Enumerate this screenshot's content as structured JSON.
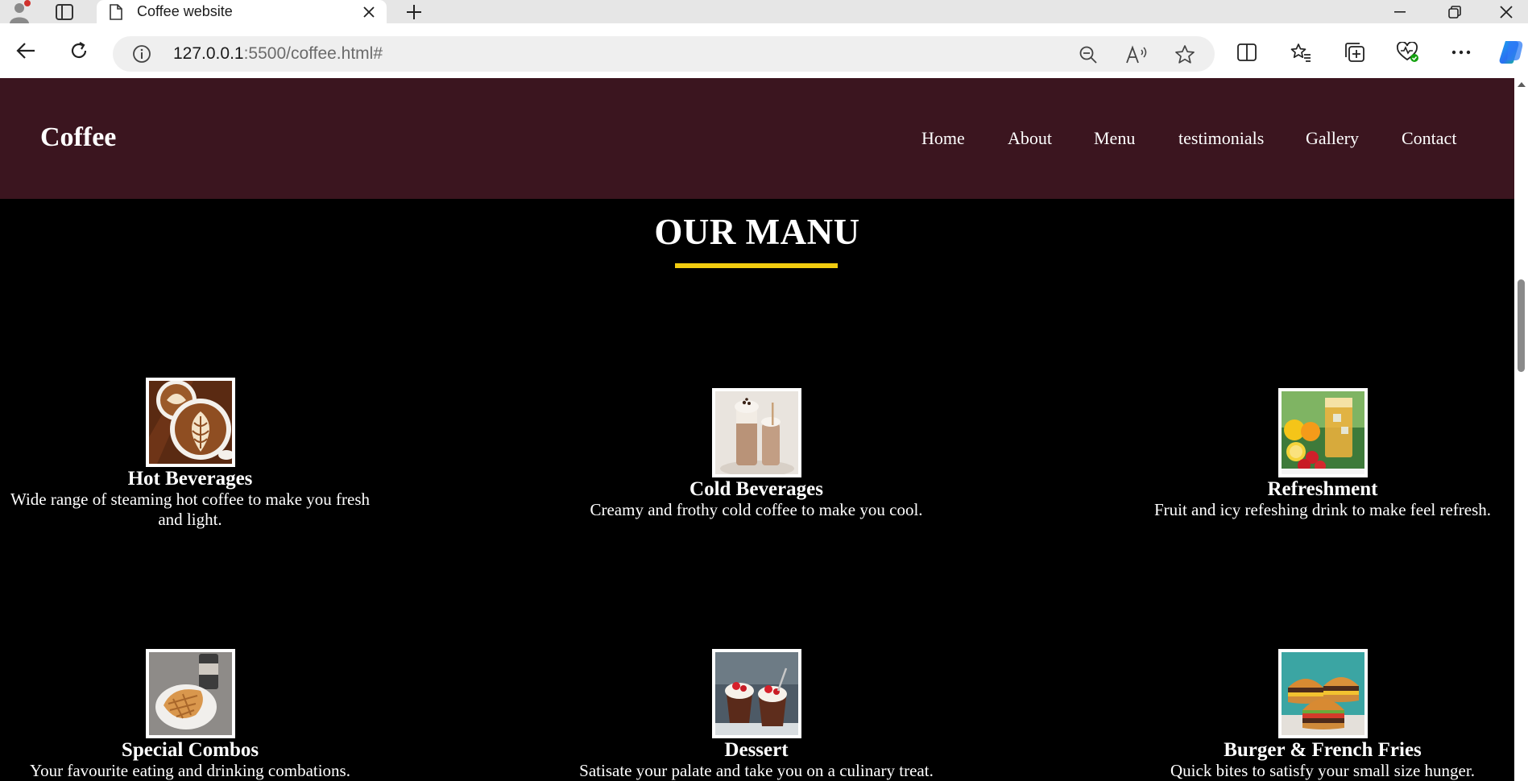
{
  "browser": {
    "tab_title": "Coffee website",
    "url_host": "127.0.0.1",
    "url_path": ":5500/coffee.html#"
  },
  "site": {
    "logo": "Coffee",
    "nav": [
      "Home",
      "About",
      "Menu",
      "testimonials",
      "Gallery",
      "Contact"
    ]
  },
  "menu_section": {
    "title": "OUR MANU",
    "items": [
      {
        "title": "Hot Beverages",
        "desc": "Wide range of steaming hot coffee to make you fresh and light.",
        "image": "latte-art-cups"
      },
      {
        "title": "Cold Beverages",
        "desc": "Creamy and frothy cold coffee to make you cool.",
        "image": "iced-coffee-glasses"
      },
      {
        "title": "Refreshment",
        "desc": "Fruit and icy refeshing drink to make feel refresh.",
        "image": "fruit-drinks"
      },
      {
        "title": "Special Combos",
        "desc": "Your favourite eating and drinking combations.",
        "image": "sandwich-and-cup"
      },
      {
        "title": "Dessert",
        "desc": "Satisate your palate and take you on a culinary treat.",
        "image": "dessert-cups"
      },
      {
        "title": "Burger & French Fries",
        "desc": "Quick bites to satisfy your small size hunger.",
        "image": "burgers"
      }
    ]
  },
  "colors": {
    "header_bg": "#3b151f",
    "page_bg": "#000000",
    "accent_underline": "#f2cc0f"
  }
}
